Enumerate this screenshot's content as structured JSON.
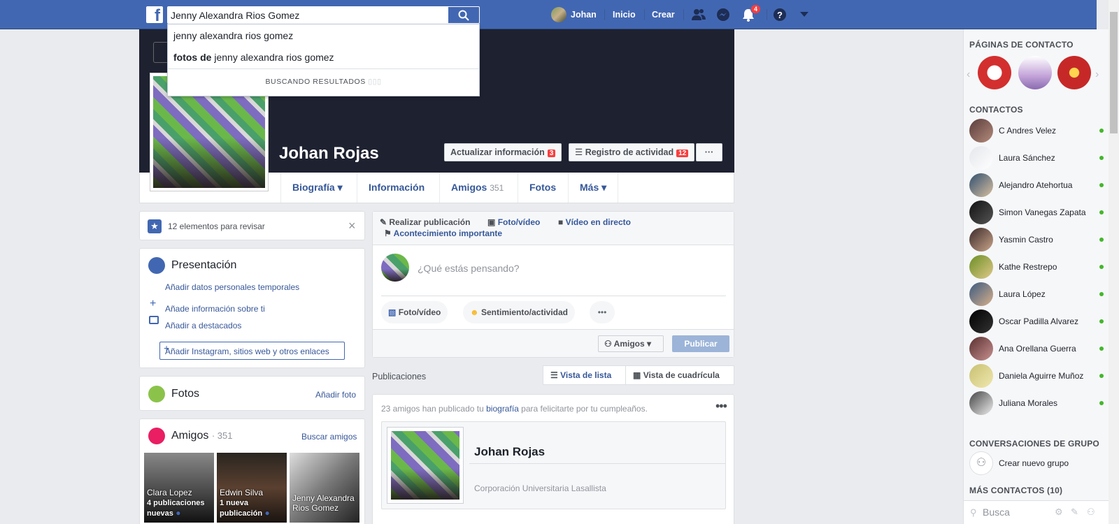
{
  "topbar": {
    "search_value": "Jenny Alexandra Rios Gomez",
    "user_name": "Johan",
    "home": "Inicio",
    "create": "Crear",
    "notif_count": "4"
  },
  "search_dropdown": {
    "suggestion1": "jenny alexandra rios gomez",
    "suggestion2_prefix": "fotos de",
    "suggestion2_rest": "jenny alexandra rios gomez",
    "status": "BUSCANDO RESULTADOS"
  },
  "profile": {
    "name": "Johan Rojas",
    "update_info": "Actualizar información",
    "update_info_count": "3",
    "activity_log": "Registro de actividad",
    "activity_log_count": "12",
    "more_dots": "···"
  },
  "tabs": {
    "biografia": "Biografía",
    "informacion": "Información",
    "amigos": "Amigos",
    "amigos_count": "351",
    "fotos": "Fotos",
    "mas": "Más"
  },
  "review": {
    "text": "12 elementos para revisar"
  },
  "intro": {
    "title": "Presentación",
    "temp": "Añadir datos personales temporales",
    "add_info": "Añade información sobre ti",
    "add_featured": "Añadir a destacados",
    "add_links": "Añadir Instagram, sitios web y otros enlaces"
  },
  "photos": {
    "title": "Fotos",
    "add": "Añadir foto"
  },
  "friends": {
    "title": "Amigos",
    "count": "· 351",
    "find": "Buscar amigos",
    "tiles": [
      {
        "name": "Clara Lopez",
        "sub": "4 publicaciones nuevas"
      },
      {
        "name": "Edwin Silva",
        "sub": "1 nueva publicación"
      },
      {
        "name": "Jenny Alexandra Rios Gomez",
        "sub": ""
      }
    ]
  },
  "composer": {
    "make_post": "Realizar publicación",
    "photo_video": "Foto/vídeo",
    "live": "Vídeo en directo",
    "life_event": "Acontecimiento importante",
    "placeholder": "¿Qué estás pensando?",
    "chip_photo": "Foto/vídeo",
    "chip_feeling": "Sentimiento/actividad",
    "chip_more": "•••",
    "audience": "Amigos",
    "publish": "Publicar"
  },
  "posts": {
    "label": "Publicaciones",
    "list_view": "Vista de lista",
    "grid_view": "Vista de cuadrícula"
  },
  "birthday_post": {
    "text_prefix": "23 amigos han publicado tu",
    "text_link": "biografía",
    "text_suffix": "para felicitarte por tu cumpleaños.",
    "name": "Johan Rojas",
    "org": "Corporación Universitaria Lasallista"
  },
  "sidebar": {
    "pages_title": "PÁGINAS DE CONTACTO",
    "contacts_title": "CONTACTOS",
    "contacts": [
      "C Andres Velez",
      "Laura Sánchez",
      "Alejandro Atehortua",
      "Simon Vanegas Zapata",
      "Yasmin Castro",
      "Kathe Restrepo",
      "Laura López",
      "Oscar Padilla Alvarez",
      "Ana Orellana Guerra",
      "Daniela Aguirre Muñoz",
      "Juliana Morales"
    ],
    "group_title": "CONVERSACIONES DE GRUPO",
    "new_group": "Crear nuevo grupo",
    "more_contacts": "MÁS CONTACTOS (10)",
    "search_placeholder": "Busca"
  },
  "colors": {
    "brand": "#4267b2",
    "online": "#42b72a",
    "badge": "#fa3e3e"
  }
}
